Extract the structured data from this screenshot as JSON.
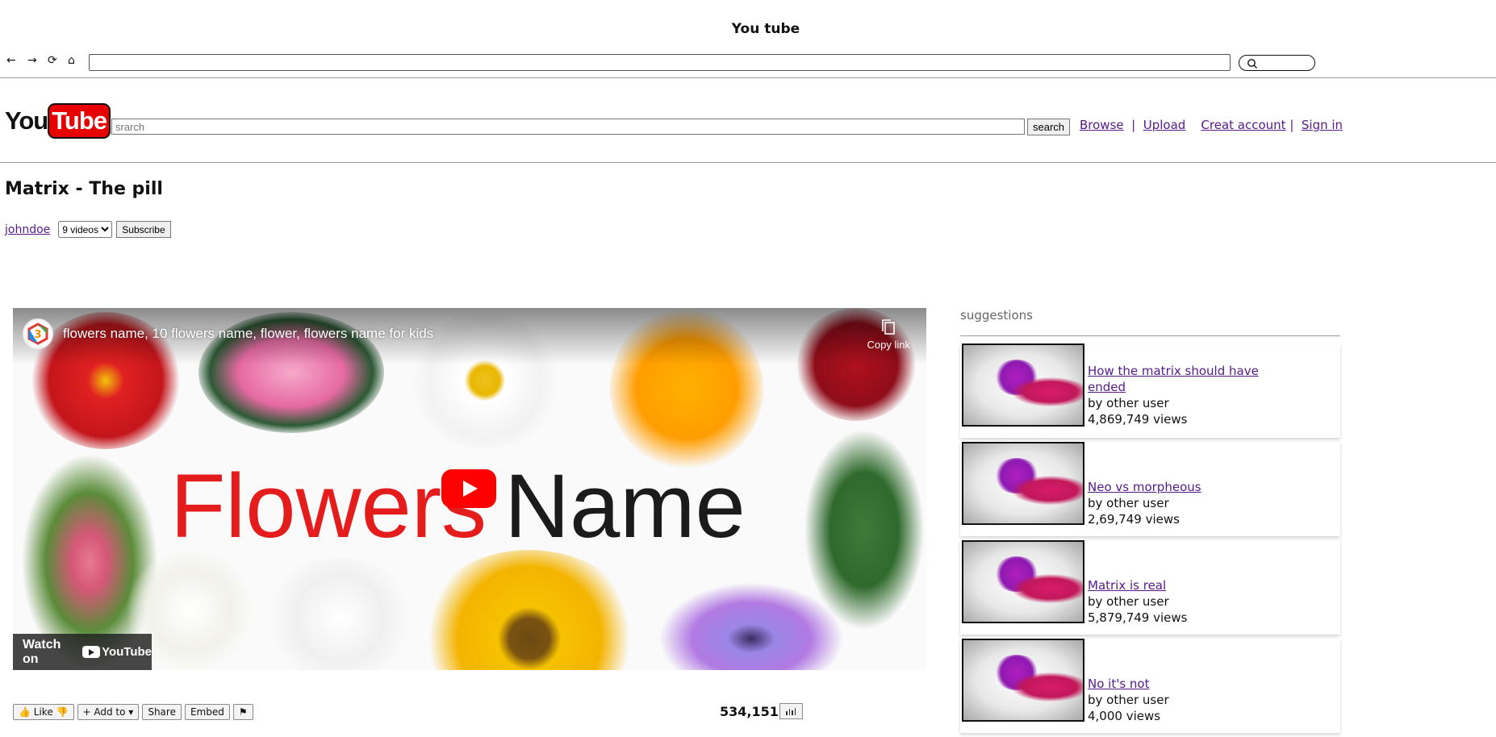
{
  "browser": {
    "window_title": "You tube",
    "back_icon": "←",
    "forward_icon": "→",
    "reload_icon": "⟳",
    "home_icon": "⌂",
    "url_value": ""
  },
  "header": {
    "logo_you": "You",
    "logo_tube": "Tube",
    "search_placeholder": "srarch",
    "search_button": "search",
    "links": [
      "Browse",
      "Upload",
      "Creat account",
      "Sign in"
    ]
  },
  "video": {
    "title": "Matrix - The pill",
    "channel": "johndoe",
    "videos_select": "9 videos",
    "subscribe": "Subscribe"
  },
  "player": {
    "embed_title": "flowers name, 10 flowers name, flower, flowers name for kids",
    "copy_link": "Copy link",
    "thumb_text_red": "Flowers",
    "thumb_text_dark": "Name",
    "watch_on": "Watch on",
    "youtube": "YouTube",
    "brand_color": "#ff0000"
  },
  "actions": {
    "like": "Like",
    "add_to": "+ Add to",
    "share": "Share",
    "embed": "Embed",
    "view_count": "534,151"
  },
  "suggestions": {
    "heading": "suggestions",
    "items": [
      {
        "title": "How the matrix should have ended",
        "by": "by other user",
        "views": "4,869,749 views"
      },
      {
        "title": "Neo vs morpheous",
        "by": "by other user",
        "views": "2,69,749 views"
      },
      {
        "title": "Matrix is real",
        "by": "by other user",
        "views": "5,879,749 views"
      },
      {
        "title": "No it's not",
        "by": "by other user",
        "views": "4,000 views"
      }
    ]
  }
}
